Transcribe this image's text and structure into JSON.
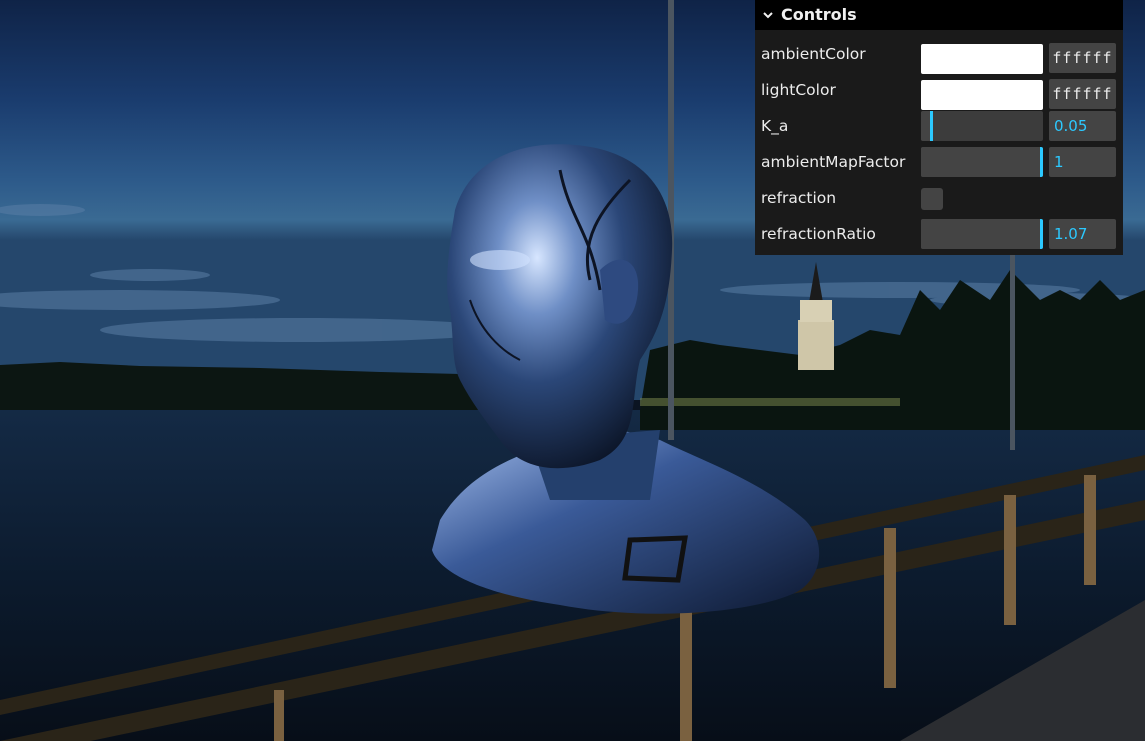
{
  "panel": {
    "title": "Controls",
    "controls": [
      {
        "label": "ambientColor",
        "type": "color",
        "hex": "ffffff",
        "color": "#ffffff"
      },
      {
        "label": "lightColor",
        "type": "color",
        "hex": "ffffff",
        "color": "#ffffff"
      },
      {
        "label": "K_a",
        "type": "slider",
        "value_text": "0.05",
        "fraction": 0.1
      },
      {
        "label": "ambientMapFactor",
        "type": "slider",
        "value_text": "1",
        "fraction": 1.0
      },
      {
        "label": "refraction",
        "type": "checkbox",
        "checked": false
      },
      {
        "label": "refractionRatio",
        "type": "slider",
        "value_text": "1.07",
        "fraction": 1.0
      }
    ]
  },
  "colors": {
    "accent": "#2cc9ff",
    "panel_bg": "#1a1a1a",
    "title_bg": "#000000"
  }
}
